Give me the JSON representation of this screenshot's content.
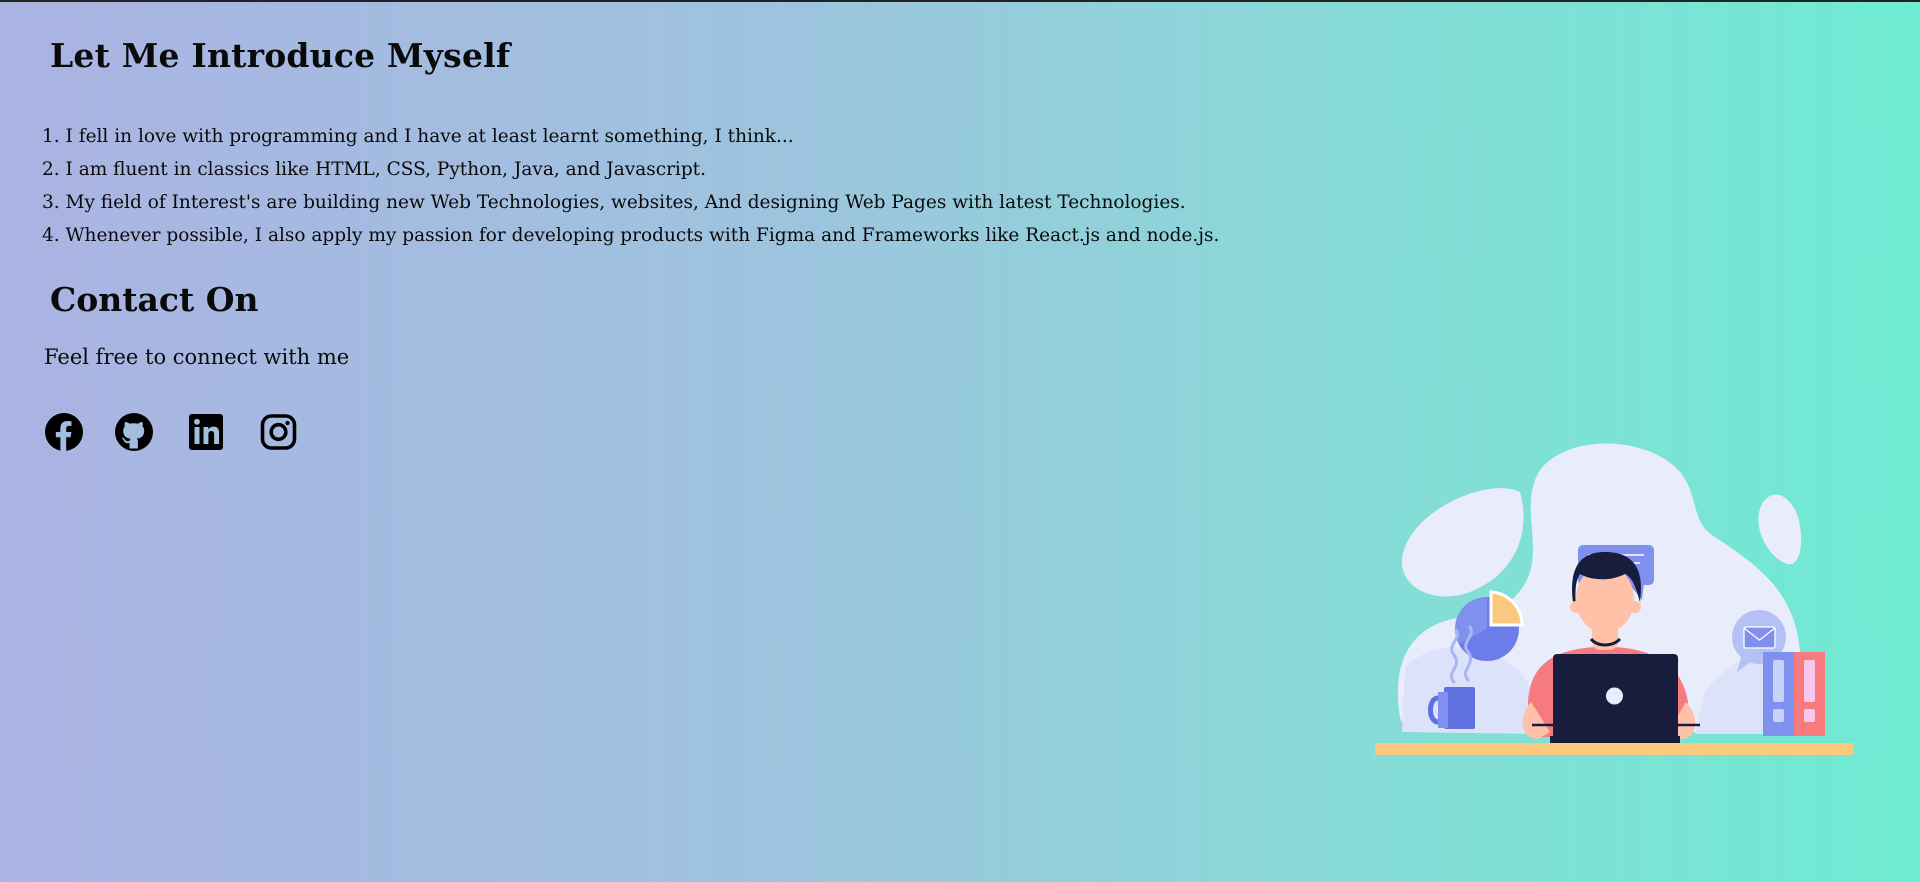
{
  "about": {
    "heading": "Let Me Introduce Myself",
    "points": [
      "1. I fell in love with programming and I have at least learnt something, I think...",
      "2. I am fluent in classics like HTML, CSS, Python, Java, and Javascript.",
      "3. My field of Interest's are building new Web Technologies, websites, And designing Web Pages with latest Technologies.",
      "4. Whenever possible, I also apply my passion for developing products with Figma and Frameworks like React.js and node.js."
    ]
  },
  "contact": {
    "heading": "Contact On",
    "subtitle": "Feel free to connect with me",
    "socials": [
      {
        "icon": "facebook-icon"
      },
      {
        "icon": "github-icon"
      },
      {
        "icon": "linkedin-icon"
      },
      {
        "icon": "instagram-icon"
      }
    ]
  },
  "colors": {
    "gradient_start": "#abb3e3",
    "gradient_end": "#6eebd3",
    "illustration_accent": "#6b7de8",
    "shirt": "#f77b7e",
    "laptop": "#181d3d"
  }
}
